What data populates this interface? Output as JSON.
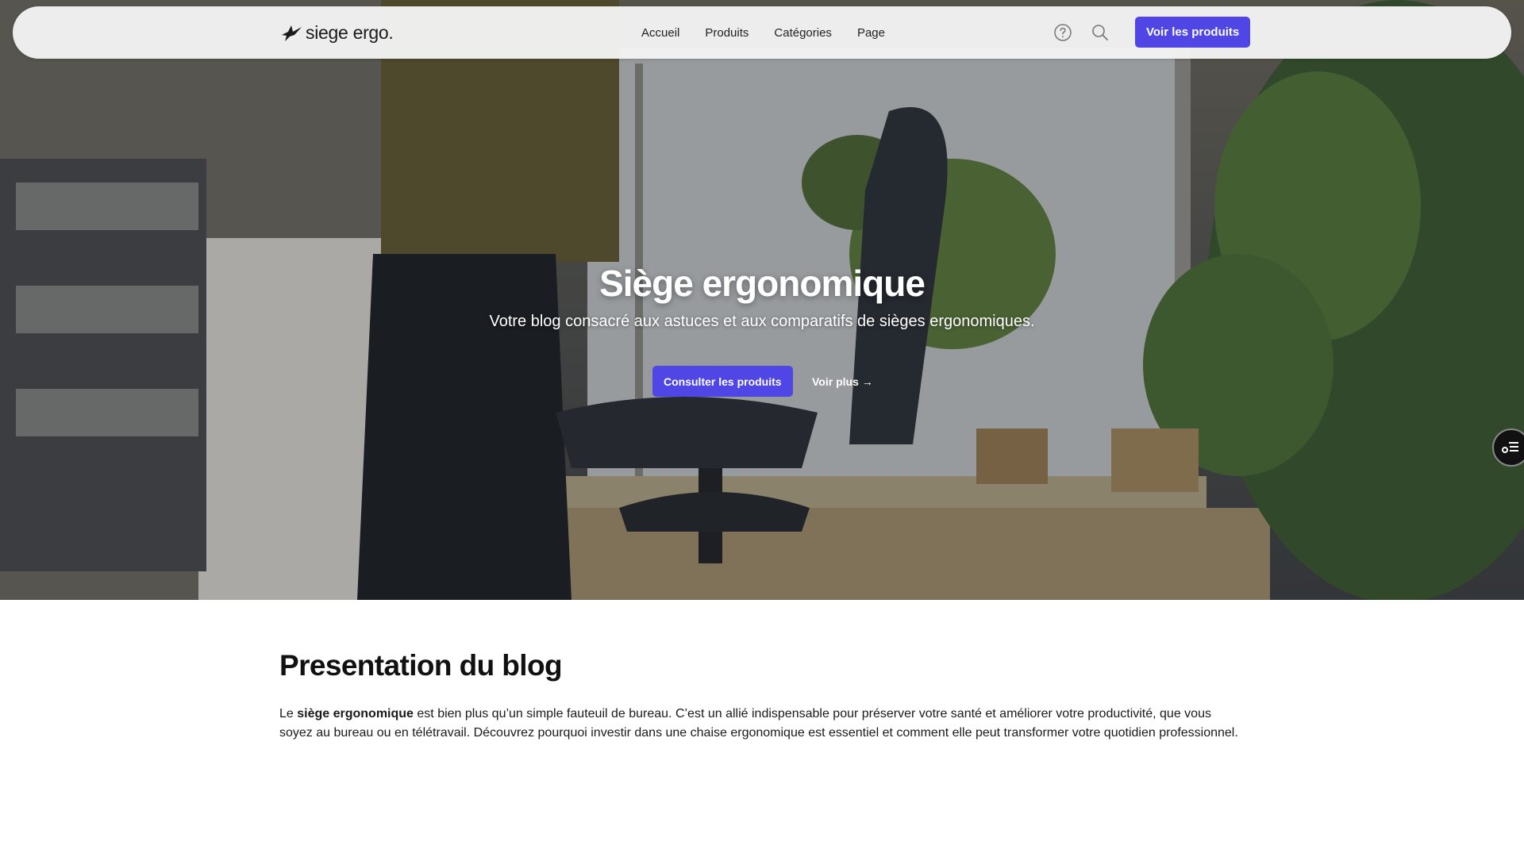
{
  "brand": {
    "name": "siege ergo."
  },
  "nav": {
    "links": [
      "Accueil",
      "Produits",
      "Catégories",
      "Page"
    ],
    "help_icon": "help-circle-icon",
    "search_icon": "search-icon",
    "cta_label": "Voir les produits"
  },
  "hero": {
    "title": "Siège ergonomique",
    "subtitle": "Votre blog consacré aux astuces et aux comparatifs de sièges ergonomiques.",
    "primary_button": "Consulter les produits",
    "secondary_link": "Voir plus →"
  },
  "side_toggle": {
    "icon": "table-of-contents-icon"
  },
  "presentation": {
    "title": "Presentation du blog",
    "text_before": "Le ",
    "text_bold": "siège ergonomique",
    "text_after": " est bien plus qu’un simple fauteuil de bureau. C’est un allié indispensable pour préserver votre santé et améliorer votre productivité, que vous soyez au bureau ou en télétravail. Découvrez pourquoi investir dans une chaise ergonomique est essentiel et comment elle peut transformer votre quotidien professionnel."
  },
  "colors": {
    "accent": "#4f46e5",
    "nav_bg": "#f3f3f3",
    "text": "#111111"
  }
}
